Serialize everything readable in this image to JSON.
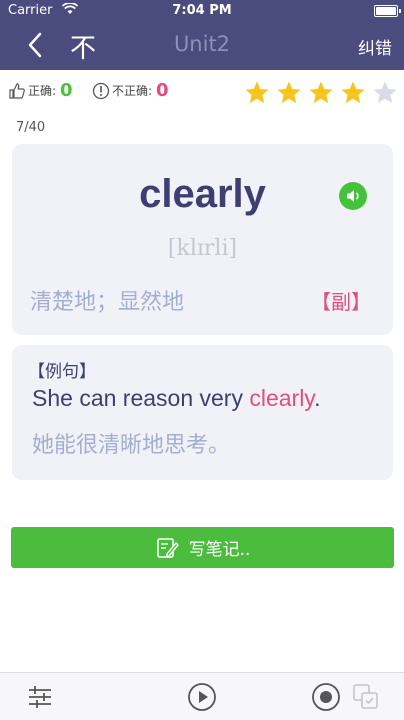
{
  "status_bar": {
    "carrier": "Carrier",
    "time": "7:04 PM",
    "wifi_icon": "wifi-icon",
    "battery_icon": "battery-icon"
  },
  "nav": {
    "back_icon": "back-chevron-icon",
    "not_know": "不",
    "title": "Unit2",
    "report": "纠错"
  },
  "stats": {
    "correct_label": "正确:",
    "correct_value": "0",
    "wrong_label": "不正确:",
    "wrong_value": "0"
  },
  "rating": {
    "filled": 4,
    "total": 5,
    "filled_color": "#f5c518",
    "empty_color": "#d9dbe2"
  },
  "progress": "7/40",
  "word": {
    "text": "clearly",
    "phonetic": "[klɪrli]",
    "meaning": "清楚地；显然地",
    "pos": "【副】"
  },
  "example": {
    "label": "【例句】",
    "sentence_before": "She can reason very ",
    "sentence_highlight": "clearly",
    "sentence_after": ".",
    "translation": "她能很清晰地思考。"
  },
  "note_button": {
    "label": "写笔记.."
  },
  "toolbar": {
    "settings_icon": "sliders-icon",
    "play_icon": "play-icon",
    "record_icon": "record-icon",
    "compare_icon": "compare-icon"
  },
  "colors": {
    "nav_bg": "#4a4c7e",
    "accent_green": "#4cbc3e",
    "accent_pink": "#e24f79",
    "text_dark": "#3d3f72"
  }
}
